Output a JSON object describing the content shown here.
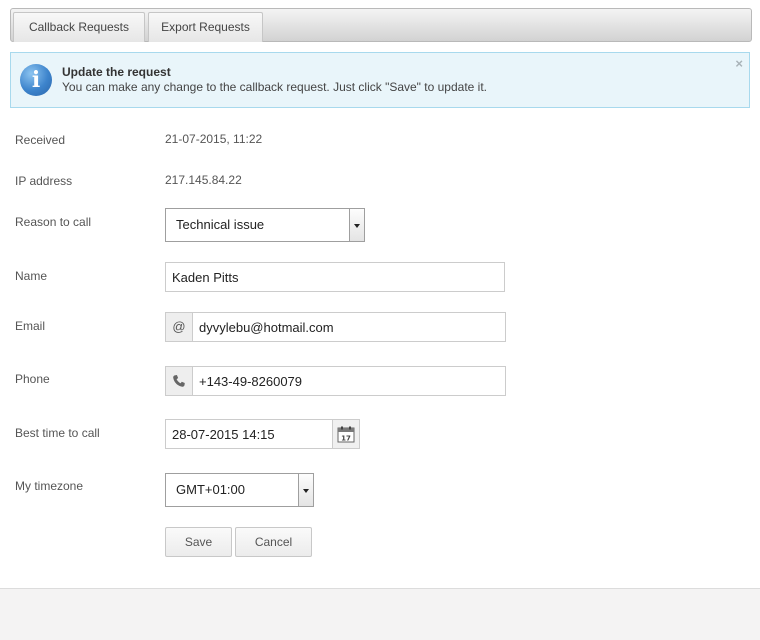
{
  "tabs": [
    {
      "label": "Callback Requests"
    },
    {
      "label": "Export Requests"
    }
  ],
  "alert": {
    "icon": "info-icon",
    "title": "Update the request",
    "text": "You can make any change to the callback request. Just click \"Save\" to update it.",
    "close": "×"
  },
  "form": {
    "received": {
      "label": "Received",
      "value": "21-07-2015, 11:22"
    },
    "ip": {
      "label": "IP address",
      "value": "217.145.84.22"
    },
    "reason": {
      "label": "Reason to call",
      "value": "Technical issue"
    },
    "name": {
      "label": "Name",
      "value": "Kaden Pitts"
    },
    "email": {
      "label": "Email",
      "value": "dyvylebu@hotmail.com",
      "addon": "@"
    },
    "phone": {
      "label": "Phone",
      "value": "+143-49-8260079",
      "icon": "phone-icon"
    },
    "best_time": {
      "label": "Best time to call",
      "value": "28-07-2015 14:15",
      "icon": "calendar-icon",
      "calendar_day": "17"
    },
    "timezone": {
      "label": "My timezone",
      "value": "GMT+01:00"
    }
  },
  "buttons": {
    "save": "Save",
    "cancel": "Cancel"
  }
}
